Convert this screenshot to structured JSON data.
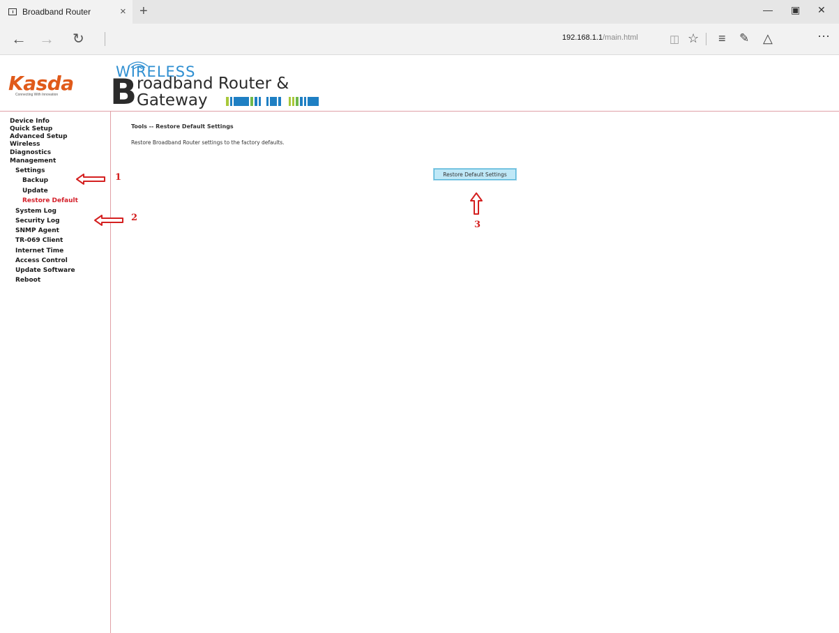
{
  "browser": {
    "tab_title": "Broadband Router",
    "tab_close": "×",
    "new_tab": "+",
    "url_host": "192.168.1.1",
    "url_path": "/main.html",
    "icons": [
      "tab-page-icon",
      "close-icon",
      "plus-icon",
      "minimize-icon",
      "maximize-icon",
      "window-close-icon",
      "back-arrow-icon",
      "forward-arrow-icon",
      "refresh-icon",
      "reading-view-icon",
      "favorite-star-icon",
      "hub-icon",
      "web-note-icon",
      "share-icon",
      "more-icon"
    ]
  },
  "header": {
    "logo_text": "Kasda",
    "logo_sub": "Connecting With Innovation",
    "wireless": "WIRELESS",
    "big_letter": "B",
    "line1": "roadband Router &",
    "line2": "Gateway"
  },
  "sidebar": {
    "items": [
      {
        "label": "Device Info"
      },
      {
        "label": "Quick Setup"
      },
      {
        "label": "Advanced Setup"
      },
      {
        "label": "Wireless"
      },
      {
        "label": "Diagnostics"
      },
      {
        "label": "Management"
      },
      {
        "label": "Settings"
      },
      {
        "label": "Backup"
      },
      {
        "label": "Update"
      },
      {
        "label": "Restore Default"
      },
      {
        "label": "System Log"
      },
      {
        "label": "Security Log"
      },
      {
        "label": "SNMP Agent"
      },
      {
        "label": "TR-069 Client"
      },
      {
        "label": "Internet Time"
      },
      {
        "label": "Access Control"
      },
      {
        "label": "Update Software"
      },
      {
        "label": "Reboot"
      }
    ],
    "active_item": "Restore Default"
  },
  "content": {
    "title": "Tools -- Restore Default Settings",
    "description": "Restore Broadband Router settings to the factory defaults.",
    "button_label": "Restore Default Settings"
  },
  "annotations": {
    "color": "#d42020",
    "labels": [
      "1",
      "2",
      "3"
    ]
  },
  "colors": {
    "accent_red": "#d4202a",
    "logo_orange": "#e05a1a",
    "wireless_blue": "#2f8fd1",
    "button_bg": "#bfe8f7",
    "rule_pink": "#e0a0a6"
  }
}
